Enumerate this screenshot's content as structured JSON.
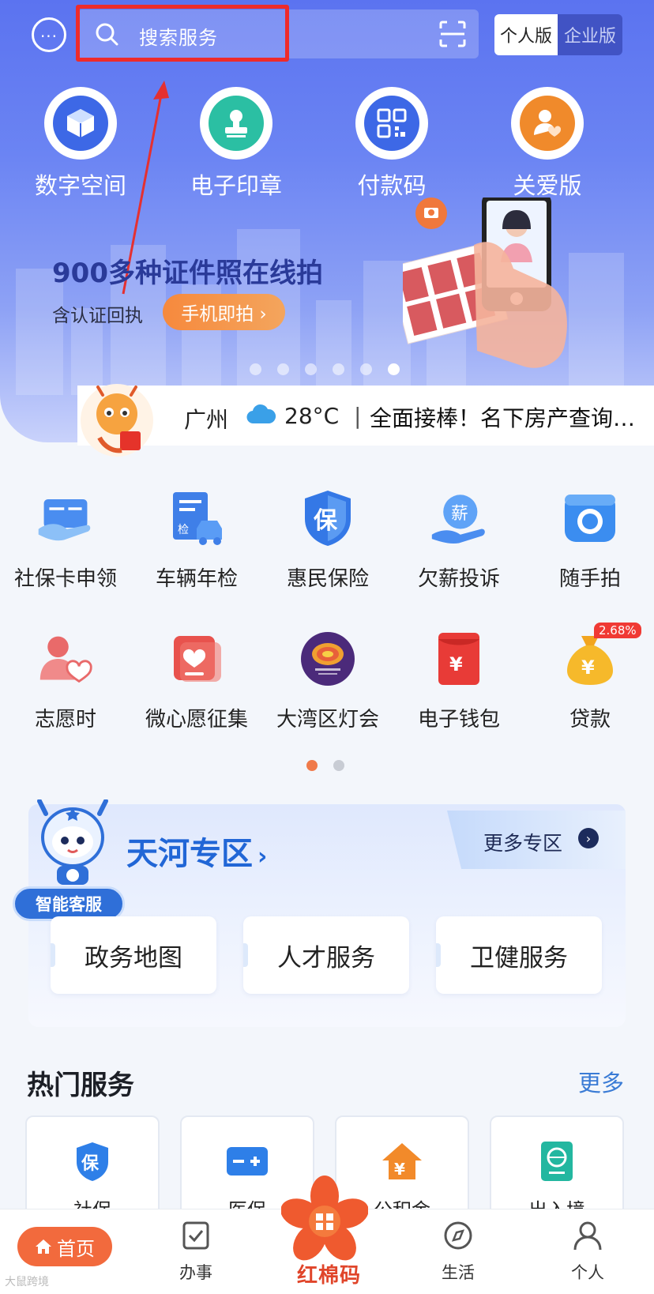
{
  "header": {
    "search_placeholder": "搜索服务",
    "version_active": "个人版",
    "version_inactive": "企业版",
    "top_items": [
      {
        "label": "数字空间",
        "icon": "cube-icon"
      },
      {
        "label": "电子印章",
        "icon": "seal-icon"
      },
      {
        "label": "付款码",
        "icon": "qr-code-icon"
      },
      {
        "label": "关爱版",
        "icon": "care-user-icon"
      }
    ],
    "banner_title": "900多种证件照在线拍",
    "banner_sub": "含认证回执",
    "banner_button": "手机即拍 ›",
    "carousel_dots": 6,
    "carousel_active": 6
  },
  "news": {
    "city": "广州",
    "temperature": "28°C",
    "separator": "|",
    "headline": "全面接棒！名下房产查询…"
  },
  "services": [
    {
      "label": "社保卡申领",
      "icon": "social-card-icon"
    },
    {
      "label": "车辆年检",
      "icon": "car-inspection-icon"
    },
    {
      "label": "惠民保险",
      "icon": "insurance-shield-icon"
    },
    {
      "label": "欠薪投诉",
      "icon": "salary-hand-icon"
    },
    {
      "label": "随手拍",
      "icon": "camera-icon"
    },
    {
      "label": "志愿时",
      "icon": "volunteer-heart-icon"
    },
    {
      "label": "微心愿征集",
      "icon": "wish-heart-icon"
    },
    {
      "label": "大湾区灯会",
      "icon": "lantern-festival-icon"
    },
    {
      "label": "电子钱包",
      "icon": "red-envelope-icon"
    },
    {
      "label": "贷款",
      "icon": "money-bag-icon"
    }
  ],
  "loan_badge": "2.68%",
  "service_pages": 2,
  "zone": {
    "title": "天河专区",
    "chevron": "›",
    "more": "更多专区",
    "assistant": "智能客服",
    "buttons": [
      "政务地图",
      "人才服务",
      "卫健服务"
    ]
  },
  "hot": {
    "title": "热门服务",
    "more": "更多",
    "items": [
      {
        "label": "社保",
        "icon": "shield-bao-icon"
      },
      {
        "label": "医保",
        "icon": "medical-card-icon"
      },
      {
        "label": "公积金",
        "icon": "house-yuan-icon"
      },
      {
        "label": "出入境",
        "icon": "passport-icon"
      }
    ]
  },
  "tabbar": {
    "home": "首页",
    "affairs": "办事",
    "center": "红棉码",
    "life": "生活",
    "personal": "个人"
  },
  "watermark": "大鼠跨境",
  "colors": {
    "header_blue": "#5b73f0",
    "accent_orange": "#f26a3d",
    "zone_blue": "#2166d6",
    "highlight_red": "#ee2b2b"
  }
}
